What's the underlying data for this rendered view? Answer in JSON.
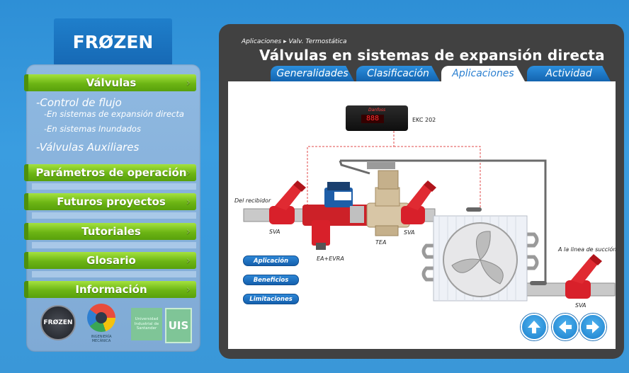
{
  "logo": {
    "text": "FRØZEN"
  },
  "menu": {
    "valvulas": "Válvulas",
    "parametros": "Parámetros de operación",
    "futuros": "Futuros proyectos",
    "tutoriales": "Tutoriales",
    "glosario": "Glosario",
    "informacion": "Información"
  },
  "submenu": {
    "control": "-Control de flujo",
    "expansion": "-En sistemas de expansión directa",
    "inundados": "-En sistemas Inundados",
    "auxiliares": "-Válvulas Auxiliares"
  },
  "footer_logos": {
    "frozen": "FRØZEN",
    "ingenieria": "INGENIERÍA MECÁNICA",
    "uis_text": "Universidad Industrial de Santander",
    "uis_mark": "UIS"
  },
  "header": {
    "breadcrumb": "Aplicaciones ▸ Valv. Termostática",
    "title": "Válvulas en sistemas de expansión directa"
  },
  "tabs": [
    "Generalidades",
    "Clasificación",
    "Aplicaciones",
    "Actividad"
  ],
  "active_tab": "Aplicaciones",
  "diagram": {
    "controller": "EKC 202",
    "controller_brand": "Danfoss",
    "controller_display": "888",
    "del_recibidor": "Del recibidor",
    "sva_left": "SVA",
    "sva_mid": "SVA",
    "tea": "TEA",
    "ea_evra": "EA+EVRA",
    "linea_succion": "A la linea de succión",
    "sva_right": "SVA"
  },
  "buttons": {
    "aplicacion": "Aplicación",
    "beneficios": "Beneficios",
    "limitaciones": "Limitaciones"
  },
  "nav": [
    "up",
    "back",
    "forward"
  ],
  "colors": {
    "menu_green": "#6cb514",
    "tab_blue": "#1f77c6",
    "panel": "#414141",
    "valve_red": "#d8202a",
    "background": "#3a97d8"
  }
}
